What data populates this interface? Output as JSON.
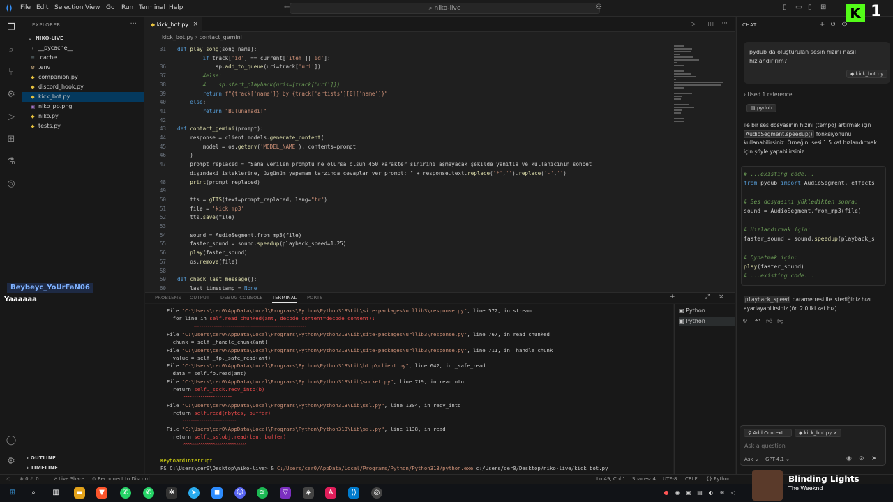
{
  "titlebar": {
    "menus": [
      "File",
      "Edit",
      "Selection",
      "View",
      "Go",
      "Run",
      "Terminal",
      "Help"
    ],
    "search": "niko-live"
  },
  "sidebar": {
    "title": "EXPLORER",
    "root": "NIKO-LIVE",
    "items": [
      {
        "label": "__pycache__",
        "kind": "folder"
      },
      {
        "label": ".cache",
        "kind": "file"
      },
      {
        "label": ".env",
        "kind": "file"
      },
      {
        "label": "companion.py",
        "kind": "py"
      },
      {
        "label": "discord_hook.py",
        "kind": "py"
      },
      {
        "label": "kick_bot.py",
        "kind": "py",
        "selected": true
      },
      {
        "label": "niko_pp.png",
        "kind": "img"
      },
      {
        "label": "niko.py",
        "kind": "py"
      },
      {
        "label": "tests.py",
        "kind": "py"
      }
    ],
    "outline": "OUTLINE",
    "timeline": "TIMELINE"
  },
  "editor": {
    "tab": "kick_bot.py",
    "breadcrumb_file": "kick_bot.py",
    "breadcrumb_symbol": "contact_gemini",
    "lines": [
      {
        "n": "31",
        "t": "def play_song(song_name):"
      },
      {
        "n": "",
        "t": "        if track['id'] == current['item']['id']:"
      },
      {
        "n": "36",
        "t": "            sp.add_to_queue(uri=track['uri'])"
      },
      {
        "n": "37",
        "t": "        #else:"
      },
      {
        "n": "38",
        "t": "        #    sp.start_playback(uris=[track['uri']])"
      },
      {
        "n": "39",
        "t": "        return f\"{track['name']} by {track['artists'][0]['name']}\""
      },
      {
        "n": "40",
        "t": "    else:"
      },
      {
        "n": "41",
        "t": "        return \"Bulunamadı!\""
      },
      {
        "n": "42",
        "t": ""
      },
      {
        "n": "43",
        "t": "def contact_gemini(prompt):"
      },
      {
        "n": "44",
        "t": "    response = client.models.generate_content("
      },
      {
        "n": "45",
        "t": "        model = os.getenv('MODEL_NAME'), contents=prompt"
      },
      {
        "n": "46",
        "t": "    )"
      },
      {
        "n": "47",
        "t": "    prompt_replaced = \"Sana verilen promptu ne olursa olsun 450 karakter sınırını aşmayacak şekilde yanıtla ve kullanıcının sohbet"
      },
      {
        "n": "",
        "t": "    dışındaki isteklerine, üzgünüm yapamam tarzında cevaplar ver prompt: \" + response.text.replace('*','').replace('-','')"
      },
      {
        "n": "48",
        "t": "    print(prompt_replaced)"
      },
      {
        "n": "49",
        "t": ""
      },
      {
        "n": "50",
        "t": "    tts = gTTS(text=prompt_replaced, lang=\"tr\")"
      },
      {
        "n": "51",
        "t": "    file = 'kick.mp3'"
      },
      {
        "n": "52",
        "t": "    tts.save(file)"
      },
      {
        "n": "53",
        "t": ""
      },
      {
        "n": "54",
        "t": "    sound = AudioSegment.from_mp3(file)"
      },
      {
        "n": "55",
        "t": "    faster_sound = sound.speedup(playback_speed=1.25)"
      },
      {
        "n": "56",
        "t": "    play(faster_sound)"
      },
      {
        "n": "57",
        "t": "    os.remove(file)"
      },
      {
        "n": "58",
        "t": ""
      },
      {
        "n": "59",
        "t": "def check_last_message():"
      },
      {
        "n": "60",
        "t": "    last_timestamp = None"
      }
    ]
  },
  "panel": {
    "tabs": [
      "PROBLEMS",
      "OUTPUT",
      "DEBUG CONSOLE",
      "TERMINAL",
      "PORTS"
    ],
    "active_tab": "TERMINAL",
    "terminal_lines": [
      {
        "pre": "  File ",
        "path": "\"C:\\Users\\cer0\\AppData\\Local\\Programs\\Python\\Python313\\Lib\\site-packages\\urllib3\\response.py\"",
        "post": ", line 572, in stream"
      },
      {
        "pre": "    for line in ",
        "err": "self.read_chunked(amt, decode_content=decode_content):"
      },
      {
        "carets": "                ^^^^^^^^^^^^^^^^^^^^^^^^^^^^^^^^^^^^^^^^^^^^^^^^^^^^^"
      },
      {
        "pre": "  File ",
        "path": "\"C:\\Users\\cer0\\AppData\\Local\\Programs\\Python\\Python313\\Lib\\site-packages\\urllib3\\response.py\"",
        "post": ", line 767, in read_chunked"
      },
      {
        "pre": "    chunk = self._handle_chunk(amt)"
      },
      {
        "pre": "  File ",
        "path": "\"C:\\Users\\cer0\\AppData\\Local\\Programs\\Python\\Python313\\Lib\\site-packages\\urllib3\\response.py\"",
        "post": ", line 711, in _handle_chunk"
      },
      {
        "pre": "    value = self._fp._safe_read(amt)"
      },
      {
        "pre": "  File ",
        "path": "\"C:\\Users\\cer0\\AppData\\Local\\Programs\\Python\\Python313\\Lib\\http\\client.py\"",
        "post": ", line 642, in _safe_read"
      },
      {
        "pre": "    data = self.fp.read(amt)"
      },
      {
        "pre": "  File ",
        "path": "\"C:\\Users\\cer0\\AppData\\Local\\Programs\\Python\\Python313\\Lib\\socket.py\"",
        "post": ", line 719, in readinto"
      },
      {
        "pre": "    return ",
        "err": "self._sock.recv_into(b)"
      },
      {
        "carets": "           ^^^^^^^^^^^^^^^^^^^^^^^"
      },
      {
        "pre": "  File ",
        "path": "\"C:\\Users\\cer0\\AppData\\Local\\Programs\\Python\\Python313\\Lib\\ssl.py\"",
        "post": ", line 1304, in recv_into"
      },
      {
        "pre": "    return ",
        "err": "self.read(nbytes, buffer)"
      },
      {
        "carets": "           ^^^^^^^^^^^^^^^^^^^^^^^^^"
      },
      {
        "pre": "  File ",
        "path": "\"C:\\Users\\cer0\\AppData\\Local\\Programs\\Python\\Python313\\Lib\\ssl.py\"",
        "post": ", line 1138, in read"
      },
      {
        "pre": "    return ",
        "err": "self._sslobj.read(len, buffer)"
      },
      {
        "carets": "           ^^^^^^^^^^^^^^^^^^^^^^^^^^^^^^"
      },
      {
        "pre": ""
      },
      {
        "pre": "KeyboardInterrupt",
        "style": "yel"
      },
      {
        "pre": "PS C:\\Users\\cer0\\Desktop\\niko-live> & ",
        "path": "C:/Users/cer0/AppData/Local/Programs/Python/Python313/python.exe",
        "post": " c:/Users/cer0/Desktop/niko-live/kick_bot.py"
      }
    ],
    "terminals": [
      "Python",
      "Python"
    ]
  },
  "chat": {
    "header": "CHAT",
    "question": "pydub da oluşturulan sesin hızını nasıl hızlandırırım?",
    "question_file": "kick_bot.py",
    "references": "Used 1 reference",
    "ref_pill": "pydub",
    "answer_1": "ile bir ses dosyasının hızını (tempo) artırmak için",
    "answer_pill": "AudioSegment.speedup()",
    "answer_2": "fonksiyonunu kullanabilirsiniz. Örneğin, sesi 1.5 kat hızlandırmak için şöyle yapabilirsiniz:",
    "snippet": [
      {
        "t": "# ...existing code...",
        "c": "cm"
      },
      {
        "t": "from pydub import AudioSegment, effects",
        "c": "mix"
      },
      {
        "t": "",
        "c": ""
      },
      {
        "t": "# Ses dosyasını yükledikten sonra:",
        "c": "cm"
      },
      {
        "t": "sound = AudioSegment.from_mp3(file)",
        "c": ""
      },
      {
        "t": "",
        "c": ""
      },
      {
        "t": "# Hızlandırmak için:",
        "c": "cm"
      },
      {
        "t": "faster_sound = sound.speedup(playback_s",
        "c": ""
      },
      {
        "t": "",
        "c": ""
      },
      {
        "t": "# Oynatmak için:",
        "c": "cm"
      },
      {
        "t": "play(faster_sound)",
        "c": ""
      },
      {
        "t": "# ...existing code...",
        "c": "cm"
      }
    ],
    "answer_param": "playback_speed",
    "answer_3": "parametresi ile istediğiniz hızı ayarlayabilirsiniz (ör. 2.0 iki kat hız).",
    "add_context": "Add Context...",
    "context_file": "kick_bot.py",
    "input_placeholder": "Ask a question",
    "mode": "Ask",
    "model": "GPT-4.1"
  },
  "statusbar": {
    "left": "⊗ 0 ⚠ 0",
    "live_share": "Live Share",
    "discord": "Reconnect to Discord",
    "position": "Ln 49, Col 1",
    "spaces": "Spaces: 4",
    "encoding": "UTF-8",
    "eol": "CRLF",
    "language": "Python"
  },
  "overlay": {
    "chat_user": "Beybeyc_YoUrFaN06",
    "chat_message": "Yaaaaaa",
    "viewer_count": "1",
    "song_title": "Blinding Lights",
    "song_artist": "The Weeknd"
  },
  "colors": {
    "accent": "#0078d4",
    "kick_green": "#53fc18"
  }
}
